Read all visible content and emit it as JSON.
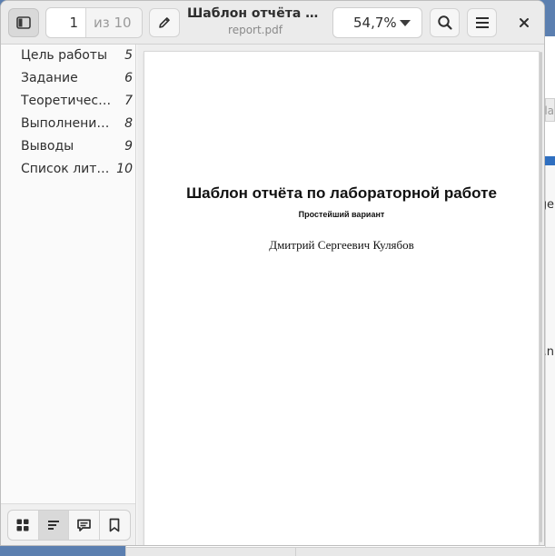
{
  "header": {
    "page_current": "1",
    "page_of": "из 10",
    "title": "Шаблон отчёта по лабораторной работе",
    "subtitle": "report.pdf",
    "zoom": "54,7%"
  },
  "icons": {
    "sidebar_toggle": "sidebar-show-icon",
    "annotate": "pencil-icon",
    "zoom_menu": "pan-down-icon",
    "search": "search-icon",
    "menu": "hamburger-menu-icon",
    "close": "window-close-icon",
    "thumbnails": "view-grid-icon",
    "outline": "outline-icon",
    "annotations": "comment-icon",
    "bookmarks": "bookmark-icon"
  },
  "sidebar": {
    "items": [
      {
        "label": "Цель работы",
        "page": "5"
      },
      {
        "label": "Задание",
        "page": "6"
      },
      {
        "label": "Теоретическое введение",
        "page": "7"
      },
      {
        "label": "Выполнение лабораторной работы",
        "page": "8"
      },
      {
        "label": "Выводы",
        "page": "9"
      },
      {
        "label": "Список литературы",
        "page": "10"
      }
    ],
    "active_view": "outline"
  },
  "document": {
    "title": "Шаблон отчёта по лабораторной работе",
    "subtitle": "Простейший вариант",
    "author": "Дмитрий Сергеевич Кулябов"
  },
  "background_peek": {
    "text_1": "la",
    "text_2": "ge",
    "text_3": ".n"
  },
  "colors": {
    "desktop": "#5b7fb0",
    "accent_strip": "#2f6fc0",
    "header_bg": "#ebebeb"
  }
}
